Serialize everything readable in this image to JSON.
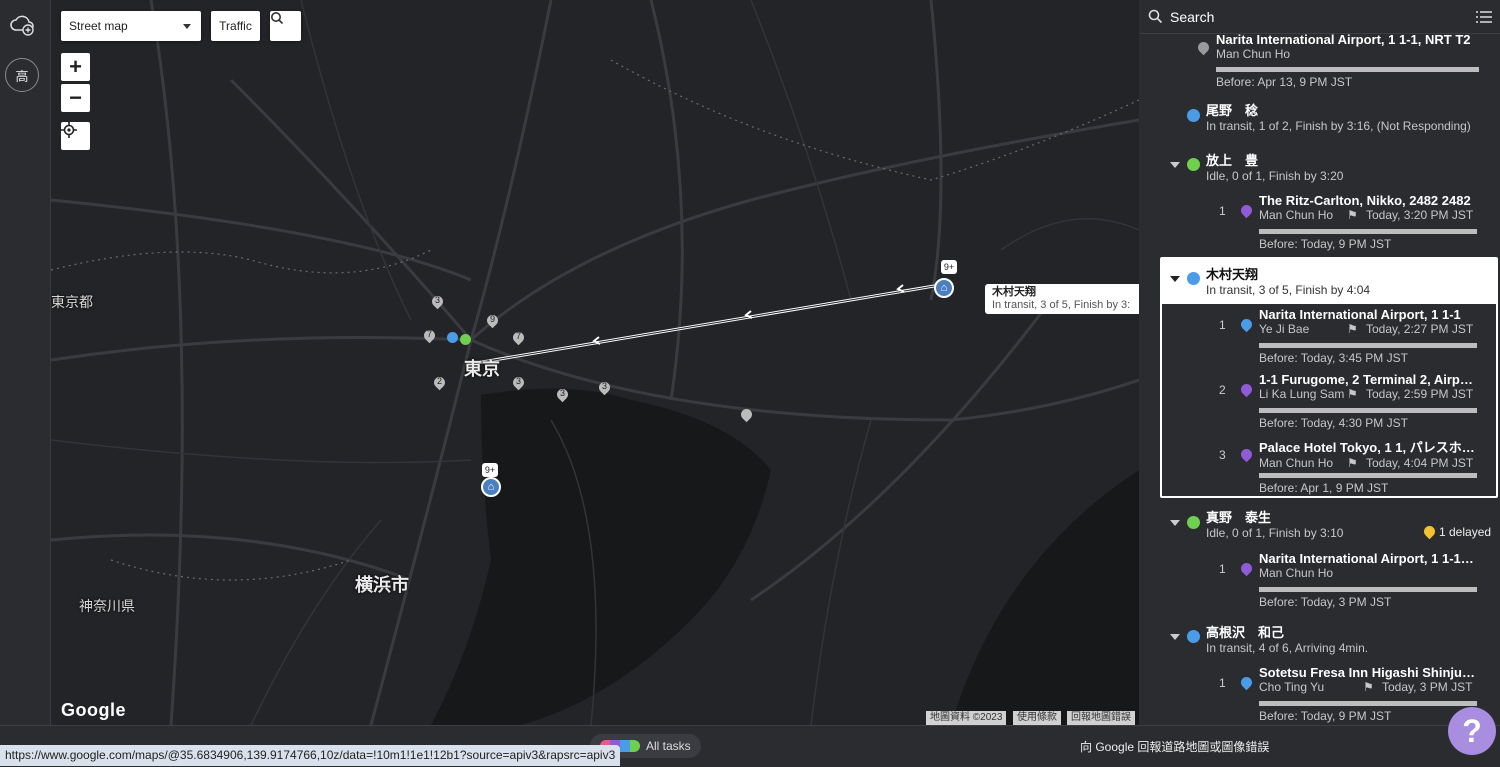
{
  "leftbar": {
    "add_icon": "cloud-add-icon",
    "avatar_label": "高"
  },
  "toolbar": {
    "map_type": "Street map",
    "traffic_label": "Traffic",
    "search_icon": "search-icon"
  },
  "zoom": {
    "plus": "+",
    "minus": "−"
  },
  "map_labels": {
    "tokyo_prefecture": "東京都",
    "tokyo": "東京",
    "yokohama": "横浜市",
    "kanagawa": "神奈川県"
  },
  "markers": [
    "3",
    "7",
    "9",
    "7",
    "2",
    "3",
    "3",
    "3",
    "9+",
    "9+"
  ],
  "tooltip": {
    "name": "木村天翔",
    "status": "In transit, 3 of 5, Finish by 3:"
  },
  "copyright": {
    "data": "地圖資料 ©2023",
    "terms": "使用條款",
    "report": "回報地圖錯誤"
  },
  "google_logo": "Google",
  "panel": {
    "search_label": "Search",
    "list_icon": "list-icon",
    "top_task": {
      "title": "Narita International Airport, 1 1-1, NRT T2",
      "person": "Man Chun Ho",
      "before": "Before: Apr 13, 9 PM JST"
    },
    "drivers": [
      {
        "name": "尾野　稔",
        "status": "In transit, 1 of 2, Finish by 3:16, (Not Responding)",
        "color": "#4a9be8"
      },
      {
        "name": "放上　豊",
        "status": "Idle, 0 of 1, Finish by 3:20",
        "color": "#6fcf4f",
        "tasks": [
          {
            "n": "1",
            "title": "The Ritz-Carlton, Nikko, 2482 2482",
            "person": "Man Chun Ho",
            "time": "Today, 3:20 PM JST",
            "before": "Before: Today, 9 PM JST",
            "pin": "#8f5bd6"
          }
        ]
      },
      {
        "name": "木村天翔",
        "status": "In transit, 3 of 5, Finish by 4:04",
        "color": "#4a9be8",
        "tasks": [
          {
            "n": "1",
            "title": "Narita International Airport, 1 1-1",
            "person": "Ye Ji Bae",
            "time": "Today, 2:27 PM JST",
            "before": "Before: Today, 3:45 PM JST",
            "pin": "#4a9be8"
          },
          {
            "n": "2",
            "title": "1-1 Furugome, 2 Terminal 2, Airp…",
            "person": "Li Ka Lung Sam",
            "time": "Today, 2:59 PM JST",
            "before": "Before: Today, 4:30 PM JST",
            "pin": "#8f5bd6"
          },
          {
            "n": "3",
            "title": "Palace Hotel Tokyo, 1 1, パレスホ…",
            "person": "Man Chun Ho",
            "time": "Today, 4:04 PM JST",
            "before": "Before: Apr 1, 9 PM JST",
            "pin": "#8f5bd6"
          }
        ]
      },
      {
        "name": "真野　泰生",
        "status": "Idle, 0 of 1, Finish by 3:10",
        "delayed": "1 delayed",
        "color": "#6fcf4f",
        "tasks": [
          {
            "n": "1",
            "title": "Narita International Airport, 1 1-1…",
            "person": "Man Chun Ho",
            "before": "Before: Today, 3 PM JST",
            "pin": "#8f5bd6"
          }
        ]
      },
      {
        "name": "高根沢　和己",
        "status": "In transit, 4 of 6, Arriving 4min.",
        "color": "#4a9be8",
        "tasks": [
          {
            "n": "1",
            "title": "Sotetsu Fresa Inn Higashi Shinju…",
            "person": "Cho Ting Yu",
            "time": "Today, 3 PM JST",
            "before": "Before: Today, 9 PM JST",
            "pin": "#4a9be8"
          }
        ]
      }
    ]
  },
  "bottom": {
    "chip_all_tasks": "All tasks",
    "report": "向 Google 回報道路地圖或圖像錯誤",
    "help": "?"
  },
  "url": "https://www.google.com/maps/@35.6834906,139.9174766,10z/data=!10m1!1e1!12b1?source=apiv3&rapsrc=apiv3"
}
